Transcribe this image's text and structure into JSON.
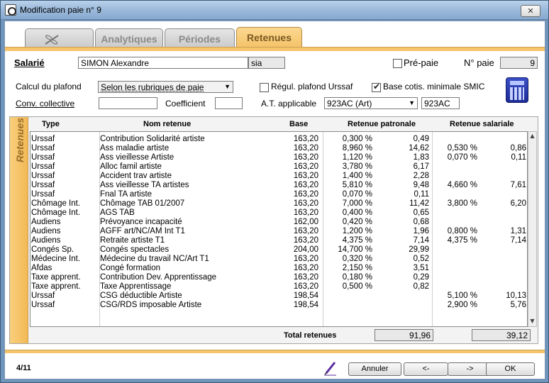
{
  "window": {
    "title": "Modification paie n° 9",
    "close_glyph": "✕"
  },
  "tabs": [
    {
      "label": "",
      "icon": "dragonfly-icon"
    },
    {
      "label": "Analytiques"
    },
    {
      "label": "Périodes"
    },
    {
      "label": "Retenues",
      "active": true
    }
  ],
  "header": {
    "salarie_label": "Salarié",
    "salarie_name": "SIMON Alexandre",
    "salarie_code": "sia",
    "prepaie_label": "Pré-paie",
    "prepaie_checked": false,
    "npaie_label": "N° paie",
    "npaie_value": "9",
    "calcul_label": "Calcul du plafond",
    "calcul_value": "Selon les rubriques de paie",
    "regul_label": "Régul. plafond Urssaf",
    "regul_checked": false,
    "base_cotis_label": "Base cotis. minimale SMIC",
    "base_cotis_checked": true,
    "conv_label": "Conv. collective",
    "conv_value": "",
    "coef_label": "Coefficient",
    "coef_value": "",
    "at_label": "A.T. applicable",
    "at_select": "923AC (Art)",
    "at_code": "923AC"
  },
  "side_label": "Retenues",
  "table": {
    "headers": {
      "type": "Type",
      "nom": "Nom retenue",
      "base": "Base",
      "patronale": "Retenue patronale",
      "salariale": "Retenue salariale"
    },
    "rows": [
      {
        "type": "Urssaf",
        "nom": "Contribution Solidarité artiste",
        "base": "163,20",
        "p_taux": "0,300 %",
        "p_montant": "0,49",
        "s_taux": "",
        "s_montant": ""
      },
      {
        "type": "Urssaf",
        "nom": "Ass maladie artiste",
        "base": "163,20",
        "p_taux": "8,960 %",
        "p_montant": "14,62",
        "s_taux": "0,530 %",
        "s_montant": "0,86"
      },
      {
        "type": "Urssaf",
        "nom": "Ass vieillesse Artiste",
        "base": "163,20",
        "p_taux": "1,120 %",
        "p_montant": "1,83",
        "s_taux": "0,070 %",
        "s_montant": "0,11"
      },
      {
        "type": "Urssaf",
        "nom": "Alloc famil artiste",
        "base": "163,20",
        "p_taux": "3,780 %",
        "p_montant": "6,17",
        "s_taux": "",
        "s_montant": ""
      },
      {
        "type": "Urssaf",
        "nom": "Accident trav artiste",
        "base": "163,20",
        "p_taux": "1,400 %",
        "p_montant": "2,28",
        "s_taux": "",
        "s_montant": ""
      },
      {
        "type": "Urssaf",
        "nom": "Ass vieillesse TA artistes",
        "base": "163,20",
        "p_taux": "5,810 %",
        "p_montant": "9,48",
        "s_taux": "4,660 %",
        "s_montant": "7,61"
      },
      {
        "type": "Urssaf",
        "nom": "Fnal TA artiste",
        "base": "163,20",
        "p_taux": "0,070 %",
        "p_montant": "0,11",
        "s_taux": "",
        "s_montant": ""
      },
      {
        "type": "Chômage Int.",
        "nom": "Chômage TAB 01/2007",
        "base": "163,20",
        "p_taux": "7,000 %",
        "p_montant": "11,42",
        "s_taux": "3,800 %",
        "s_montant": "6,20"
      },
      {
        "type": "Chômage Int.",
        "nom": "AGS TAB",
        "base": "163,20",
        "p_taux": "0,400 %",
        "p_montant": "0,65",
        "s_taux": "",
        "s_montant": ""
      },
      {
        "type": "Audiens",
        "nom": "Prévoyance incapacité",
        "base": "162,00",
        "p_taux": "0,420 %",
        "p_montant": "0,68",
        "s_taux": "",
        "s_montant": ""
      },
      {
        "type": "Audiens",
        "nom": "AGFF art/NC/AM Int T1",
        "base": "163,20",
        "p_taux": "1,200 %",
        "p_montant": "1,96",
        "s_taux": "0,800 %",
        "s_montant": "1,31"
      },
      {
        "type": "Audiens",
        "nom": "Retraite artiste T1",
        "base": "163,20",
        "p_taux": "4,375 %",
        "p_montant": "7,14",
        "s_taux": "4,375 %",
        "s_montant": "7,14"
      },
      {
        "type": "Congés Sp.",
        "nom": "Congés spectacles",
        "base": "204,00",
        "p_taux": "14,700 %",
        "p_montant": "29,99",
        "s_taux": "",
        "s_montant": ""
      },
      {
        "type": "Médecine Int.",
        "nom": "Médecine du travail NC/Art T1",
        "base": "163,20",
        "p_taux": "0,320 %",
        "p_montant": "0,52",
        "s_taux": "",
        "s_montant": ""
      },
      {
        "type": "Afdas",
        "nom": "Congé formation",
        "base": "163,20",
        "p_taux": "2,150 %",
        "p_montant": "3,51",
        "s_taux": "",
        "s_montant": ""
      },
      {
        "type": "Taxe apprent.",
        "nom": "Contribution Dev. Apprentissage",
        "base": "163,20",
        "p_taux": "0,180 %",
        "p_montant": "0,29",
        "s_taux": "",
        "s_montant": ""
      },
      {
        "type": "Taxe apprent.",
        "nom": "Taxe Apprentissage",
        "base": "163,20",
        "p_taux": "0,500 %",
        "p_montant": "0,82",
        "s_taux": "",
        "s_montant": ""
      },
      {
        "type": "Urssaf",
        "nom": "CSG déductible Artiste",
        "base": "198,54",
        "p_taux": "",
        "p_montant": "",
        "s_taux": "5,100 %",
        "s_montant": "10,13"
      },
      {
        "type": "Urssaf",
        "nom": "CSG/RDS imposable Artiste",
        "base": "198,54",
        "p_taux": "",
        "p_montant": "",
        "s_taux": "2,900 %",
        "s_montant": "5,76"
      }
    ],
    "total_label": "Total retenues",
    "total_patronale": "91,96",
    "total_salariale": "39,12"
  },
  "footer": {
    "page": "4/11",
    "cancel": "Annuler",
    "prev": "<-",
    "next": "->",
    "ok": "OK"
  }
}
